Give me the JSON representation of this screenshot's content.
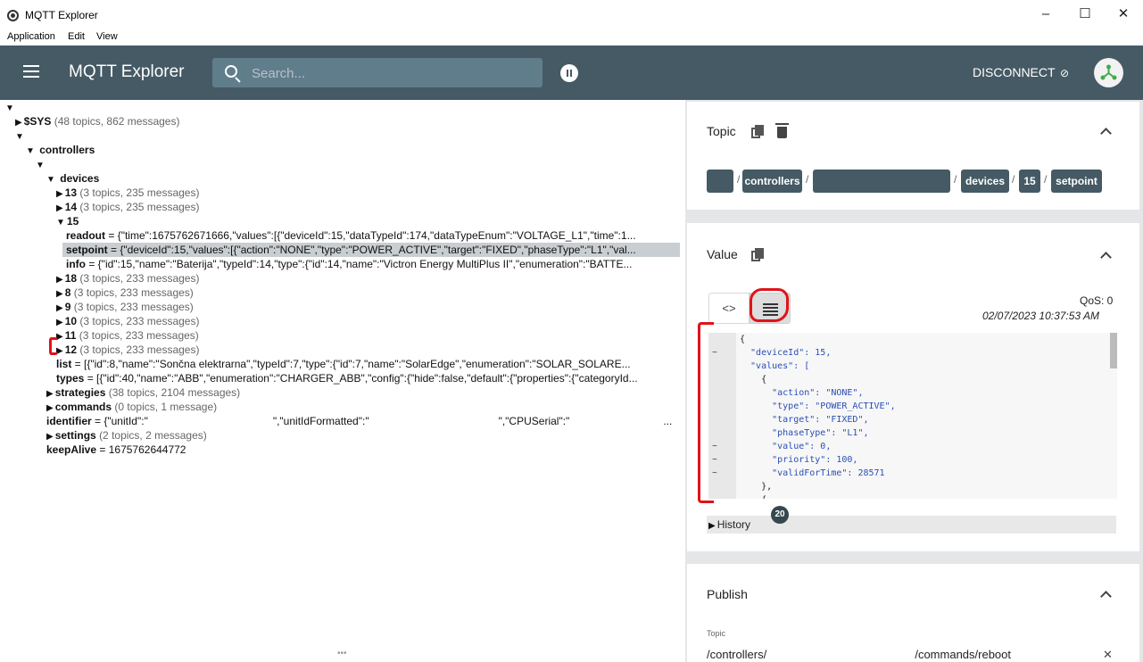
{
  "window": {
    "title": "MQTT Explorer",
    "minimize": "–",
    "maximize": "☐",
    "close": "✕"
  },
  "menu": [
    "Application",
    "Edit",
    "View"
  ],
  "appbar": {
    "title": "MQTT Explorer",
    "search_placeholder": "Search...",
    "disconnect_label": "DISCONNECT",
    "cloud_off_icon": "cloud-off-icon",
    "accent": "#455a64"
  },
  "tree": {
    "sys": {
      "key": "$SYS",
      "count": "(48 topics, 862 messages)"
    },
    "controllers": "controllers",
    "devices": "devices",
    "dev13": {
      "key": "13",
      "count": "(3 topics, 235 messages)"
    },
    "dev14": {
      "key": "14",
      "count": "(3 topics, 235 messages)"
    },
    "dev15": "15",
    "readout": {
      "key": "readout",
      "value": " = {\"time\":1675762671666,\"values\":[{\"deviceId\":15,\"dataTypeId\":174,\"dataTypeEnum\":\"VOLTAGE_L1\",\"time\":1..."
    },
    "setpoint": {
      "key": "setpoint",
      "value": " = {\"deviceId\":15,\"values\":[{\"action\":\"NONE\",\"type\":\"POWER_ACTIVE\",\"target\":\"FIXED\",\"phaseType\":\"L1\",\"val..."
    },
    "info": {
      "key": "info",
      "value": " = {\"id\":15,\"name\":\"Baterija\",\"typeId\":14,\"type\":{\"id\":14,\"name\":\"Victron Energy MultiPlus II\",\"enumeration\":\"BATTE..."
    },
    "dev18": {
      "key": "18",
      "count": "(3 topics, 233 messages)"
    },
    "dev8": {
      "key": "8",
      "count": "(3 topics, 233 messages)"
    },
    "dev9": {
      "key": "9",
      "count": "(3 topics, 233 messages)"
    },
    "dev10": {
      "key": "10",
      "count": "(3 topics, 233 messages)"
    },
    "dev11": {
      "key": "11",
      "count": "(3 topics, 233 messages)"
    },
    "dev12": {
      "key": "12",
      "count": "(3 topics, 233 messages)"
    },
    "list": {
      "key": "list",
      "value": " = [{\"id\":8,\"name\":\"Sončna elektrarna\",\"typeId\":7,\"type\":{\"id\":7,\"name\":\"SolarEdge\",\"enumeration\":\"SOLAR_SOLARE..."
    },
    "types": {
      "key": "types",
      "value": " = [{\"id\":40,\"name\":\"ABB\",\"enumeration\":\"CHARGER_ABB\",\"config\":{\"hide\":false,\"default\":{\"properties\":{\"categoryId..."
    },
    "strategies": {
      "key": "strategies",
      "count": "(38 topics, 2104 messages)"
    },
    "commands": {
      "key": "commands",
      "count": "(0 topics, 1 message)"
    },
    "identifier": {
      "key": "identifier",
      "v1": " = {\"unitId\":\"",
      "v2": "\",\"unitIdFormatted\":\"",
      "v3": "\",\"CPUSerial\":\"",
      "v4": "..."
    },
    "settings": {
      "key": "settings",
      "count": "(2 topics, 2 messages)"
    },
    "keepalive": {
      "key": "keepAlive",
      "value": " = 1675762644772"
    }
  },
  "topic_card": {
    "title": "Topic",
    "crumbs": [
      "controllers",
      "devices",
      "15",
      "setpoint"
    ],
    "separator": "/"
  },
  "value_card": {
    "title": "Value",
    "code_toggle": "<>",
    "qos": "QoS: 0",
    "timestamp": "02/07/2023 10:37:53 AM",
    "code_lines": [
      "{",
      "  \"deviceId\": 15,",
      "  \"values\": [",
      "    {",
      "      \"action\": \"NONE\",",
      "      \"type\": \"POWER_ACTIVE\",",
      "      \"target\": \"FIXED\",",
      "      \"phaseType\": \"L1\",",
      "      \"value\": 0,",
      "      \"priority\": 100,",
      "      \"validForTime\": 28571",
      "    },",
      "    {"
    ],
    "history_label": "History",
    "history_count": "20"
  },
  "publish_card": {
    "title": "Publish",
    "topic_label": "Topic",
    "topic_value": "/controllers/                                              /commands/reboot",
    "clear": "✕"
  },
  "colors": {
    "annotation": "#e0131b",
    "badge": "#37474f"
  }
}
